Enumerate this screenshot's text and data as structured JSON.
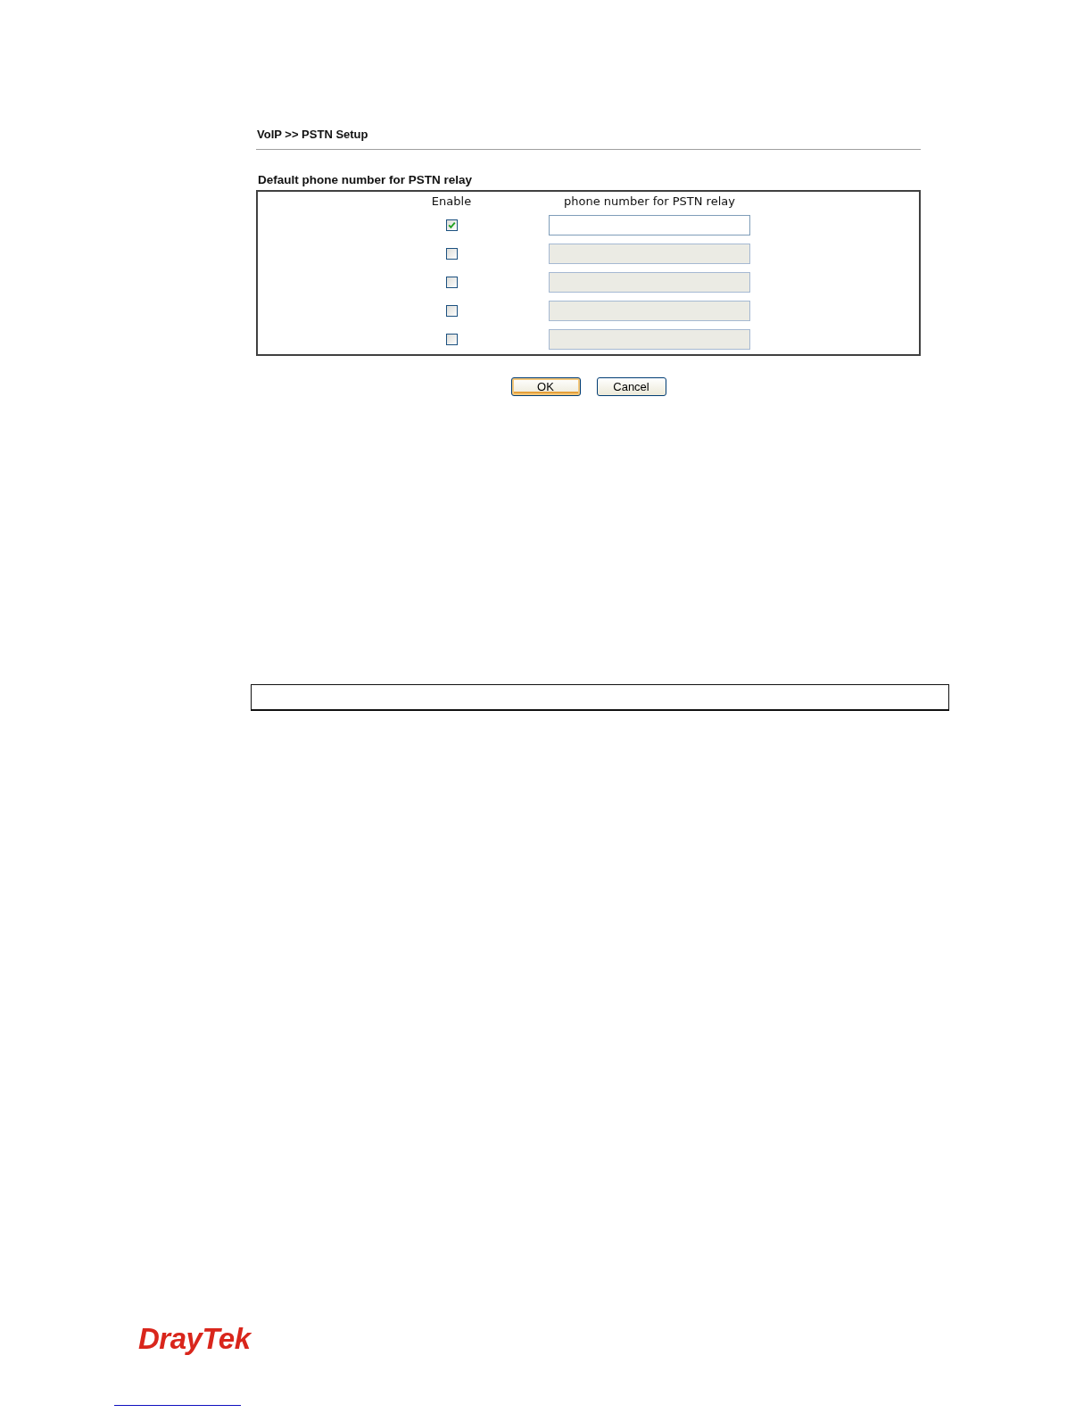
{
  "breadcrumb": "VoIP >> PSTN Setup",
  "section_title": "Default phone number for PSTN relay",
  "table": {
    "columns": [
      "Enable",
      "phone number for PSTN relay"
    ],
    "rows": [
      {
        "checked": true,
        "disabled": false
      },
      {
        "checked": false,
        "disabled": true
      },
      {
        "checked": false,
        "disabled": true
      },
      {
        "checked": false,
        "disabled": true
      },
      {
        "checked": false,
        "disabled": true
      }
    ]
  },
  "buttons": [
    {
      "label": "OK",
      "focused": true
    },
    {
      "label": "Cancel",
      "focused": false
    }
  ],
  "footer": {
    "logo": "DrayTek"
  }
}
